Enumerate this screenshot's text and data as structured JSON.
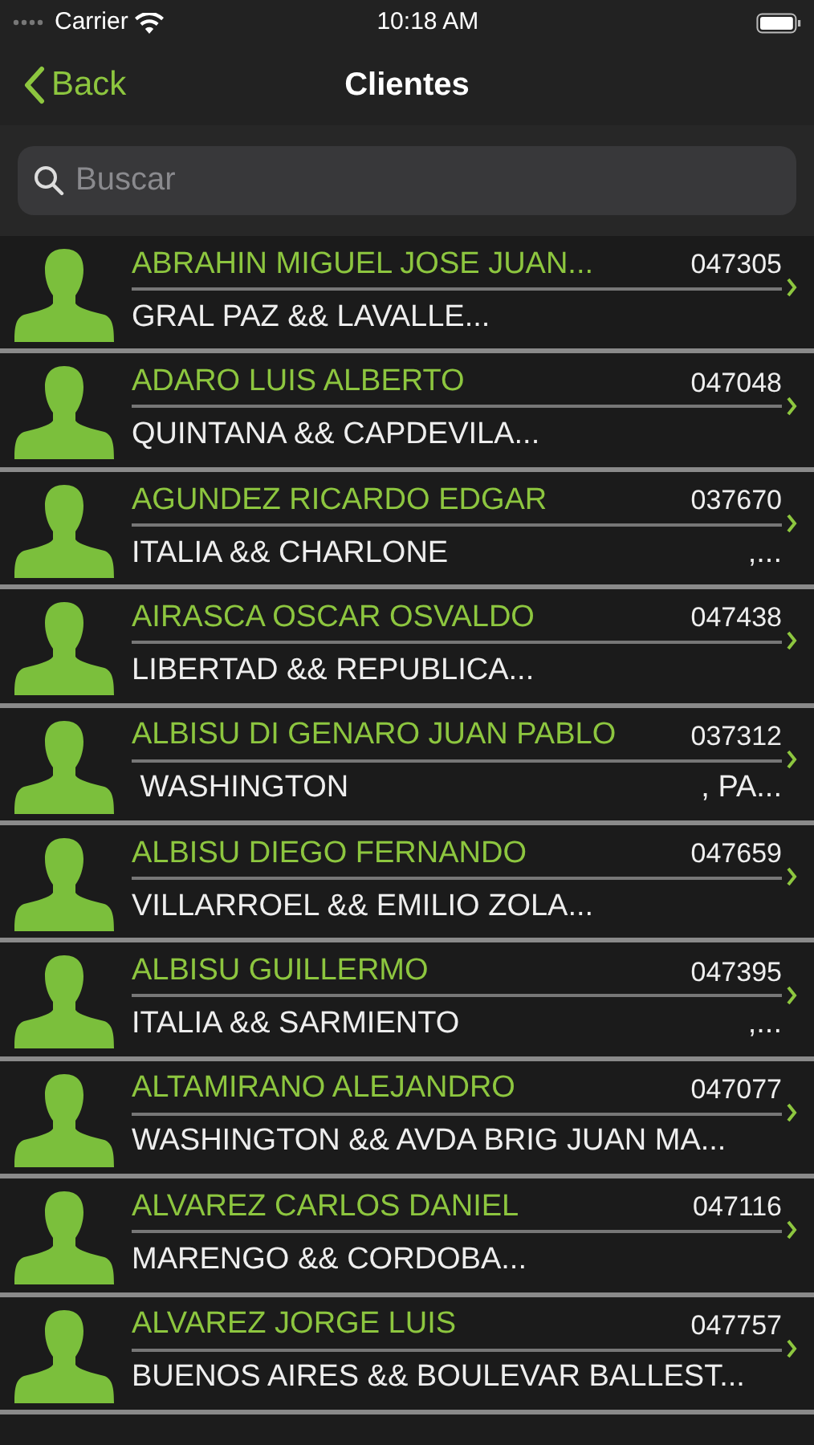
{
  "status_bar": {
    "carrier": "Carrier",
    "time": "10:18 AM"
  },
  "nav": {
    "back": "Back",
    "title": "Clientes"
  },
  "search": {
    "placeholder": "Buscar"
  },
  "clients": [
    {
      "name": "ABRAHIN MIGUEL JOSE JUAN...",
      "code": "047305",
      "address": "GRAL PAZ && LAVALLE..."
    },
    {
      "name": "ADARO LUIS ALBERTO",
      "code": "047048",
      "address": "QUINTANA && CAPDEVILA..."
    },
    {
      "name": "AGUNDEZ RICARDO EDGAR",
      "code": "037670",
      "address": "ITALIA && CHARLONE",
      "address_end": ",..."
    },
    {
      "name": "AIRASCA OSCAR OSVALDO",
      "code": "047438",
      "address": "LIBERTAD && REPUBLICA..."
    },
    {
      "name": "ALBISU DI GENARO JUAN PABLO",
      "code": "037312",
      "address": " WASHINGTON",
      "address_end": ", PA..."
    },
    {
      "name": "ALBISU DIEGO FERNANDO",
      "code": "047659",
      "address": "VILLARROEL && EMILIO ZOLA..."
    },
    {
      "name": "ALBISU GUILLERMO",
      "code": "047395",
      "address": "ITALIA && SARMIENTO",
      "address_end": ",..."
    },
    {
      "name": "ALTAMIRANO ALEJANDRO",
      "code": "047077",
      "address": "WASHINGTON && AVDA BRIG JUAN MA..."
    },
    {
      "name": "ALVAREZ CARLOS DANIEL",
      "code": "047116",
      "address": "MARENGO && CORDOBA..."
    },
    {
      "name": "ALVAREZ JORGE LUIS",
      "code": "047757",
      "address": "BUENOS AIRES && BOULEVAR BALLEST..."
    }
  ]
}
